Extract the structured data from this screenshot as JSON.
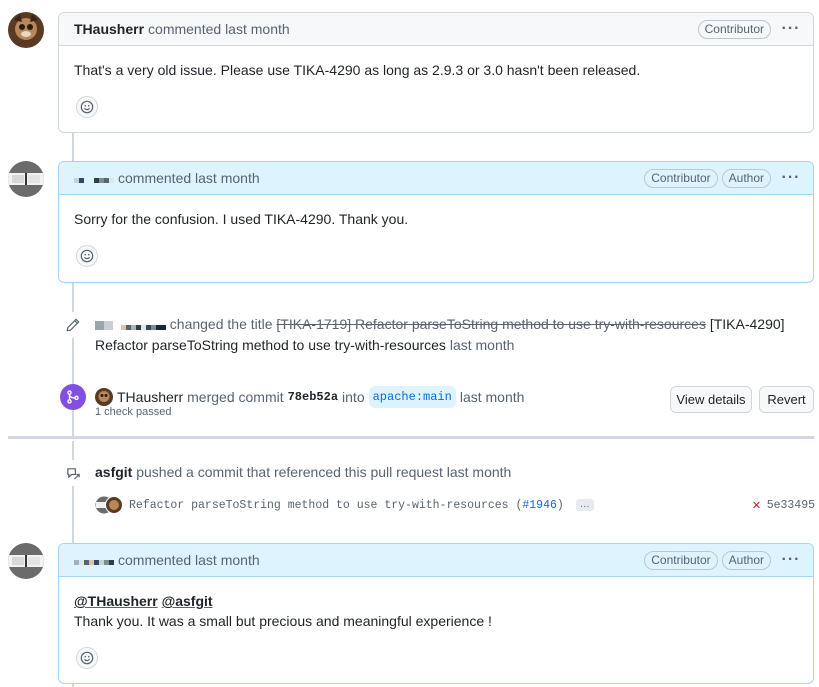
{
  "comments": [
    {
      "author": "THausherr",
      "action": "commented last month",
      "badges": [
        "Contributor"
      ],
      "body": "That's a very old issue. Please use TIKA-4290 as long as 2.9.3 or 3.0 hasn't been released."
    },
    {
      "action": "commented last month",
      "badges": [
        "Contributor",
        "Author"
      ],
      "body": "Sorry for the confusion. I used TIKA-4290. Thank you."
    },
    {
      "action": "commented last month",
      "badges": [
        "Contributor",
        "Author"
      ],
      "mentions": [
        "@THausherr",
        "@asfgit"
      ],
      "body": "Thank you. It was a small but precious and meaningful experience !"
    }
  ],
  "title_change": {
    "verb": "changed the title",
    "old_title": "[TIKA-1719] Refactor parseToString method to use try-with-resources",
    "new_title": "[TIKA-4290] Refactor parseToString method to use try-with-resources",
    "time": "last month"
  },
  "merge_event": {
    "author": "THausherr",
    "verb": "merged commit",
    "sha": "78eb52a",
    "into": "into",
    "branch": "apache:main",
    "time": "last month",
    "checks": "1 check passed",
    "view_details_label": "View details",
    "revert_label": "Revert"
  },
  "push_event": {
    "author": "asfgit",
    "text": "pushed a commit that referenced this pull request last month",
    "commit_message": "Refactor parseToString method to use try-with-resources (",
    "commit_pr": "#1946",
    "commit_suffix": ")",
    "ellipsis": "…",
    "commit_sha": "5e33495",
    "status": "failed"
  },
  "icons": [
    "kebab-icon",
    "smiley-icon",
    "pencil-icon",
    "merge-icon",
    "cross-reference-icon",
    "x-icon"
  ],
  "colors": {
    "author_header_bg": "#ddf4ff",
    "author_border": "#a5d4f5",
    "merge_badge": "#8250df",
    "link": "#0969da",
    "failure": "#d1242f"
  }
}
